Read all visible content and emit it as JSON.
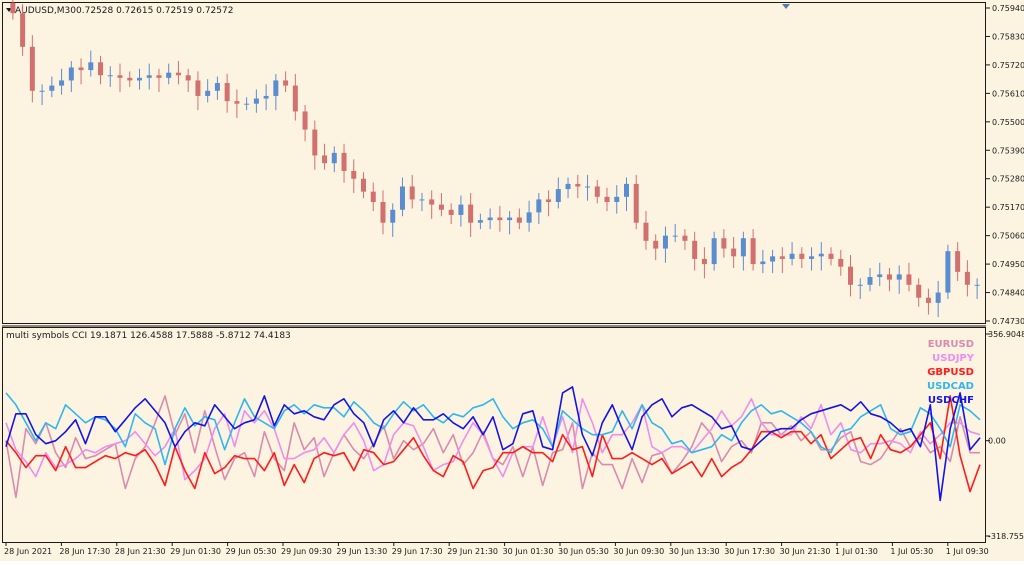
{
  "main_chart": {
    "symbol_label": "AUDUSD,M30",
    "ohlc_label": "0.72528 0.72615 0.72519 0.72572",
    "price_axis": [
      "0.75940",
      "0.75830",
      "0.75720",
      "0.75610",
      "0.75500",
      "0.75390",
      "0.75280",
      "0.75170",
      "0.75060",
      "0.74950",
      "0.74840",
      "0.74730"
    ],
    "price_range": [
      0.7473,
      0.7594
    ],
    "up_color": "#5b8ccf",
    "down_color": "#d2706f"
  },
  "indicator": {
    "label": "multi symbols CCI 19.1871 126.4588 17.5888 -5.8712 74.4183",
    "axis": [
      "356.9048",
      "0.00",
      "-318.7551"
    ],
    "range": [
      -318.7551,
      356.9048
    ],
    "legend": [
      {
        "name": "EURUSD",
        "color": "#d98bb0"
      },
      {
        "name": "USDJPY",
        "color": "#ee8eee"
      },
      {
        "name": "GBPUSD",
        "color": "#ff1c1c"
      },
      {
        "name": "USDCAD",
        "color": "#2fb7ee"
      },
      {
        "name": "USDCHF",
        "color": "#1414e6"
      }
    ]
  },
  "time_axis": [
    "28 Jun 2021",
    "28 Jun 17:30",
    "28 Jun 21:30",
    "29 Jun 01:30",
    "29 Jun 05:30",
    "29 Jun 09:30",
    "29 Jun 13:30",
    "29 Jun 17:30",
    "29 Jun 21:30",
    "30 Jun 01:30",
    "30 Jun 05:30",
    "30 Jun 09:30",
    "30 Jun 13:30",
    "30 Jun 17:30",
    "30 Jun 21:30",
    "1 Jul 01:30",
    "1 Jul 05:30",
    "1 Jul 09:30"
  ],
  "colors": {
    "background": "#fdf3e1",
    "grid_text": "#1a1a1a"
  },
  "chart_data": [
    {
      "type": "candlestick",
      "title": "AUDUSD,M30",
      "ylim": [
        0.7473,
        0.7594
      ],
      "close_path": [
        0.7592,
        0.7579,
        0.7562,
        0.7562,
        0.7564,
        0.7566,
        0.7571,
        0.757,
        0.7573,
        0.7568,
        0.7568,
        0.7567,
        0.7566,
        0.7567,
        0.7568,
        0.7567,
        0.7569,
        0.7568,
        0.7566,
        0.756,
        0.7562,
        0.7565,
        0.7558,
        0.7557,
        0.7557,
        0.7559,
        0.756,
        0.7566,
        0.7564,
        0.7554,
        0.7547,
        0.7537,
        0.7534,
        0.7538,
        0.7531,
        0.7528,
        0.7523,
        0.7519,
        0.7511,
        0.7516,
        0.7525,
        0.752,
        0.752,
        0.7518,
        0.7516,
        0.7514,
        0.7518,
        0.7511,
        0.7512,
        0.7513,
        0.7512,
        0.7513,
        0.7511,
        0.7515,
        0.752,
        0.7519,
        0.7524,
        0.7526,
        0.7525,
        0.7525,
        0.7521,
        0.7519,
        0.7521,
        0.7526,
        0.7511,
        0.7504,
        0.7501,
        0.7506,
        0.7506,
        0.7504,
        0.7497,
        0.7495,
        0.7505,
        0.7501,
        0.7498,
        0.7505,
        0.7495,
        0.7496,
        0.7498,
        0.7497,
        0.7499,
        0.7497,
        0.7498,
        0.7499,
        0.7497,
        0.7494,
        0.7487,
        0.7487,
        0.749,
        0.7491,
        0.7489,
        0.7491,
        0.7487,
        0.7482,
        0.748,
        0.7484,
        0.75,
        0.7492,
        0.7487,
        0.7487
      ]
    },
    {
      "type": "line",
      "title": "multi symbols CCI",
      "ylim": [
        -318.7551,
        356.9048
      ],
      "series": [
        {
          "name": "EURUSD",
          "values": [
            0,
            -190,
            40,
            -10,
            60,
            -40,
            -90,
            10,
            -60,
            -50,
            -30,
            -10,
            -160,
            -60,
            -20,
            60,
            150,
            20,
            90,
            -40,
            100,
            -20,
            -130,
            -60,
            -40,
            -120,
            30,
            -60,
            -100,
            60,
            -30,
            10,
            -120,
            -40,
            20,
            -30,
            -60,
            -10,
            50,
            -60,
            0,
            -30,
            -10,
            40,
            -40,
            20,
            -80,
            -40,
            30,
            -60,
            -80,
            -20,
            -120,
            -20,
            -150,
            -40,
            -30,
            60,
            -160,
            -40,
            -80,
            -80,
            -160,
            -60,
            -140,
            -50,
            -40,
            -110,
            -70,
            -20,
            60,
            20,
            -70,
            -20,
            0,
            -40,
            60,
            60,
            20,
            50,
            0,
            30,
            -30,
            -30,
            10,
            30,
            -70,
            -80,
            -60,
            -10,
            40,
            -20,
            10,
            -40,
            -20,
            -70,
            80,
            -40,
            -40
          ]
        },
        {
          "name": "USDJPY",
          "values": [
            60,
            -30,
            -70,
            -120,
            -40,
            -90,
            -80,
            -60,
            -30,
            -40,
            -20,
            -10,
            0,
            30,
            -10,
            -50,
            -20,
            40,
            -130,
            -100,
            -60,
            40,
            90,
            -20,
            100,
            60,
            100,
            40,
            -60,
            -60,
            -40,
            -30,
            10,
            -40,
            20,
            60,
            0,
            -100,
            -80,
            20,
            60,
            50,
            -20,
            -100,
            -80,
            -70,
            0,
            60,
            20,
            -60,
            -120,
            -40,
            -20,
            -20,
            80,
            -20,
            80,
            -40,
            140,
            60,
            -40,
            20,
            20,
            60,
            120,
            -20,
            -40,
            -20,
            -20,
            -40,
            0,
            40,
            100,
            50,
            80,
            140,
            60,
            20,
            20,
            20,
            80,
            40,
            120,
            20,
            60,
            -30,
            -40,
            -10,
            -10,
            0,
            -10,
            -40,
            30,
            -10,
            20,
            60,
            60,
            30,
            20
          ]
        },
        {
          "name": "GBPUSD",
          "values": [
            0,
            -40,
            -90,
            -50,
            -50,
            -100,
            -20,
            -90,
            -90,
            -70,
            -50,
            -60,
            -40,
            -50,
            -30,
            -80,
            -150,
            -20,
            -100,
            -160,
            -40,
            -110,
            -90,
            -50,
            -60,
            -60,
            -100,
            -40,
            -150,
            -80,
            -140,
            -60,
            -40,
            -50,
            -40,
            -100,
            -30,
            -40,
            -80,
            -70,
            -30,
            10,
            -50,
            -100,
            -120,
            -50,
            -70,
            -160,
            -100,
            -90,
            -40,
            -40,
            -20,
            -40,
            -40,
            -70,
            20,
            -30,
            -20,
            -120,
            20,
            -60,
            -60,
            -40,
            -60,
            -80,
            -60,
            -110,
            -90,
            -70,
            -120,
            -60,
            -120,
            -90,
            -70,
            -30,
            30,
            30,
            10,
            30,
            30,
            -10,
            20,
            -60,
            -30,
            0,
            10,
            -60,
            20,
            -30,
            -40,
            -20,
            20,
            60,
            -60,
            150,
            -50,
            -170,
            -80
          ]
        },
        {
          "name": "USDCAD",
          "values": [
            160,
            120,
            60,
            0,
            60,
            40,
            120,
            90,
            60,
            80,
            70,
            40,
            -20,
            90,
            60,
            40,
            -80,
            40,
            110,
            50,
            80,
            70,
            -30,
            60,
            140,
            80,
            60,
            40,
            100,
            120,
            90,
            120,
            110,
            110,
            80,
            130,
            100,
            60,
            40,
            90,
            130,
            100,
            120,
            80,
            60,
            90,
            80,
            110,
            120,
            140,
            80,
            40,
            60,
            70,
            40,
            -20,
            100,
            70,
            40,
            20,
            20,
            30,
            100,
            40,
            120,
            60,
            40,
            -10,
            0,
            -40,
            -30,
            -20,
            20,
            0,
            60,
            100,
            120,
            90,
            100,
            80,
            60,
            30,
            -20,
            -40,
            30,
            40,
            80,
            100,
            120,
            40,
            20,
            30,
            110,
            90,
            40,
            -20,
            120,
            100,
            70
          ]
        },
        {
          "name": "USDCHF",
          "values": [
            -20,
            90,
            90,
            20,
            -10,
            0,
            30,
            70,
            -10,
            80,
            80,
            30,
            70,
            110,
            140,
            100,
            60,
            -20,
            30,
            60,
            50,
            120,
            80,
            40,
            60,
            70,
            150,
            50,
            120,
            90,
            100,
            80,
            70,
            120,
            140,
            90,
            60,
            -20,
            70,
            100,
            60,
            110,
            70,
            70,
            90,
            60,
            40,
            80,
            20,
            80,
            -30,
            -10,
            90,
            100,
            -20,
            -30,
            160,
            180,
            20,
            -50,
            60,
            120,
            40,
            -30,
            80,
            120,
            140,
            80,
            110,
            120,
            100,
            80,
            40,
            50,
            -20,
            -30,
            0,
            30,
            40,
            40,
            70,
            90,
            100,
            110,
            120,
            100,
            130,
            90,
            80,
            60,
            30,
            40,
            -20,
            120,
            -200,
            40,
            160,
            -30,
            10
          ]
        }
      ]
    }
  ]
}
